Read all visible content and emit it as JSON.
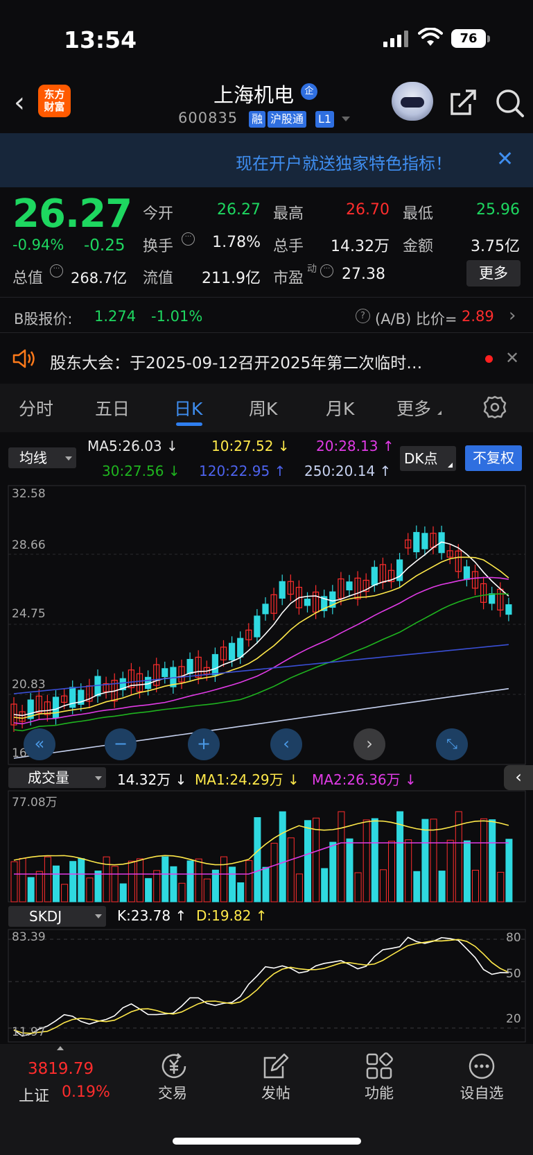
{
  "status_bar": {
    "time": "13:54",
    "battery": "76"
  },
  "header": {
    "logo_line1": "东方",
    "logo_line2": "财富",
    "name": "上海机电",
    "name_badge": "企",
    "code": "600835",
    "tags": [
      "融",
      "沪股通",
      "L1"
    ]
  },
  "banner": {
    "text": "现在开户就送独家特色指标！"
  },
  "quote": {
    "price": "26.27",
    "change_pct": "-0.94%",
    "change_amt": "-0.25",
    "fields": {
      "open_label": "今开",
      "open": "26.27",
      "high_label": "最高",
      "high": "26.70",
      "low_label": "最低",
      "low": "25.96",
      "turnover_label": "换手",
      "turnover": "1.78%",
      "volume_label": "总手",
      "volume": "14.32万",
      "amount_label": "金额",
      "amount": "3.75亿",
      "mktcap_label": "总值",
      "mktcap": "268.7亿",
      "float_label": "流值",
      "float": "211.9亿",
      "pe_label": "市盈",
      "pe_super": "动",
      "pe": "27.38"
    },
    "more": "更多"
  },
  "b_share": {
    "label": "B股报价:",
    "price": "1.274",
    "pct": "-1.01%",
    "ratio_label": "(A/B) 比价=",
    "ratio": "2.89"
  },
  "notice": {
    "text": "股东大会：于2025-09-12召开2025年第二次临时…"
  },
  "tabs": [
    "分时",
    "五日",
    "日K",
    "周K",
    "月K",
    "更多"
  ],
  "ma_panel": {
    "selector": "均线",
    "ma5": "MA5:26.03",
    "ma5_dir": "↓",
    "ma10": "10:27.52",
    "ma10_dir": "↓",
    "ma20": "20:28.13",
    "ma20_dir": "↑",
    "ma30": "30:27.56",
    "ma30_dir": "↓",
    "ma120": "120:22.95",
    "ma120_dir": "↑",
    "ma250": "250:20.14",
    "ma250_dir": "↑",
    "dk": "DK点",
    "adjust": "不复权"
  },
  "y_axis": [
    "32.58",
    "28.66",
    "24.75",
    "20.83",
    "16.92"
  ],
  "volume_panel": {
    "selector": "成交量",
    "vol": "14.32万",
    "vol_dir": "↓",
    "ma1": "MA1:24.29万",
    "ma1_dir": "↓",
    "ma2": "MA2:26.36万",
    "ma2_dir": "↓",
    "max": "77.08万"
  },
  "skdj_panel": {
    "selector": "SKDJ",
    "k": "K:23.78",
    "k_dir": "↑",
    "d": "D:19.82",
    "d_dir": "↑",
    "max": "83.39",
    "min": "11.97",
    "levels": [
      "80",
      "50",
      "20"
    ]
  },
  "bottom_nav": {
    "index_value": "3819.79",
    "index_name": "上证",
    "index_pct": "0.19%",
    "items": [
      "交易",
      "发帖",
      "功能",
      "设自选"
    ]
  },
  "colors": {
    "up": "#ff2d2d",
    "down": "#1ed760",
    "accent": "#2f7ff0",
    "ma5": "#ffffff",
    "ma10": "#ffe94a",
    "ma20": "#e13be6",
    "ma30": "#1fb41f",
    "ma120": "#3a4fd6",
    "ma250": "#c7d2f0"
  }
}
